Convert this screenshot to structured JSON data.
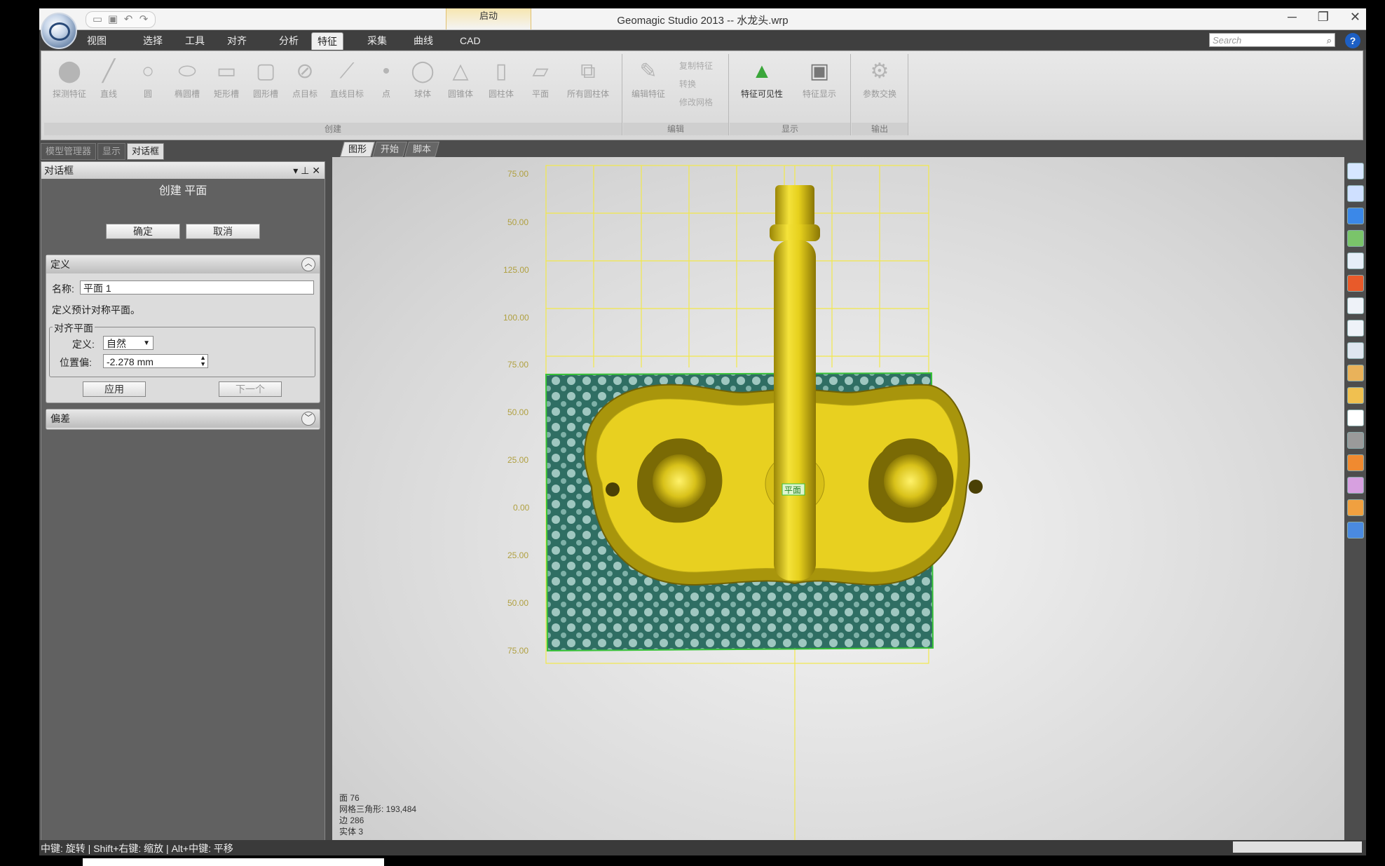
{
  "window": {
    "title": "Geomagic Studio 2013 -- 水龙头.wrp",
    "context_tab": "启动",
    "controls": [
      "─",
      "❐",
      "✕"
    ]
  },
  "qat_icons": [
    "new-icon",
    "save-icon",
    "undo-icon",
    "redo-icon"
  ],
  "ribbon_tabs": [
    "视图",
    "选择",
    "工具",
    "对齐",
    "分析",
    "特征",
    "采集",
    "曲线",
    "CAD"
  ],
  "active_tab": "特征",
  "search_placeholder": "Search",
  "help_label": "?",
  "ribbon": {
    "groups": [
      {
        "label": "创建",
        "buttons": [
          "探测特征",
          "直线",
          "圆",
          "椭圆槽",
          "矩形槽",
          "圆形槽",
          "点目标",
          "直线目标",
          "点",
          "球体",
          "圆锥体",
          "圆柱体",
          "平面",
          "所有圆柱体"
        ]
      },
      {
        "label": "编辑",
        "buttons": [
          "编辑特征"
        ],
        "small": [
          "复制特征",
          "转换",
          "修改网格"
        ]
      },
      {
        "label": "显示",
        "buttons": [
          "特征可见性",
          "特征显示"
        ]
      },
      {
        "label": "输出",
        "buttons": [
          "参数交换"
        ]
      }
    ]
  },
  "left_panel": {
    "tabs": [
      "模型管理器",
      "显示",
      "对话框"
    ],
    "active_tab": "对话框",
    "header": "对话框",
    "header_controls": "▾ ⊥ ✕",
    "subtitle": "创建 平面",
    "ok": "确定",
    "cancel": "取消",
    "definition": {
      "title": "定义",
      "name_label": "名称:",
      "name_value": "平面 1",
      "hint": "定义预计对称平面。",
      "align_plane_legend": "对齐平面",
      "define_label": "定义:",
      "define_value": "自然",
      "offset_label": "位置偏:",
      "offset_value": "-2.278 mm",
      "apply": "应用",
      "next": "下一个"
    },
    "deviation": {
      "title": "偏差"
    }
  },
  "viewport": {
    "tabs": [
      "图形",
      "开始",
      "脚本"
    ],
    "active_tab": "图形",
    "axis_labels": [
      "75.00",
      "50.00",
      "125.00",
      "100.00",
      "75.00",
      "50.00",
      "25.00",
      "0.00",
      "25.00",
      "50.00",
      "75.00"
    ],
    "feature_tag": "平面",
    "stats": {
      "faces": "面 76",
      "triangles": "网格三角形: 193,484",
      "edges": "边 286",
      "solids": "实体 3"
    }
  },
  "right_toolbar_icons": [
    "view-icon",
    "rotate-icon",
    "box-icon",
    "feature-icon",
    "zoom-icon",
    "target-icon",
    "select-rect-icon",
    "lasso-icon",
    "pen-icon",
    "brush-icon",
    "paint-icon",
    "export-icon",
    "cursor-icon",
    "layer-icon",
    "layer2-icon",
    "layer3-icon",
    "layer4-icon"
  ],
  "status_bar": {
    "text": "中键: 旋转 | Shift+右键: 缩放 | Alt+中键: 平移"
  },
  "colors": {
    "part_yellow": "#e8d020",
    "grid_yellow": "#f2e84a",
    "plane_teal": "#2f6e63",
    "plane_edge": "#38c238"
  }
}
